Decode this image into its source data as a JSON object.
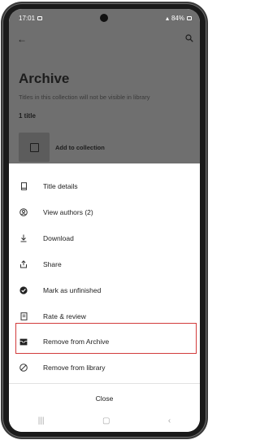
{
  "status_bar": {
    "time": "17:01",
    "battery": "84%"
  },
  "background": {
    "title": "Archive",
    "subtitle": "Titles in this collection will not be visible in library",
    "count": "1 title",
    "add_label": "Add to collection"
  },
  "menu": {
    "items": [
      {
        "label": "Title details",
        "icon": "book-icon"
      },
      {
        "label": "View authors (2)",
        "icon": "author-icon"
      },
      {
        "label": "Download",
        "icon": "download-icon"
      },
      {
        "label": "Share",
        "icon": "share-icon"
      },
      {
        "label": "Mark as unfinished",
        "icon": "check-circle-icon"
      },
      {
        "label": "Rate & review",
        "icon": "review-icon"
      },
      {
        "label": "Remove from Archive",
        "icon": "archive-icon"
      },
      {
        "label": "Remove from library",
        "icon": "ban-icon"
      }
    ],
    "close_label": "Close"
  },
  "colors": {
    "highlight": "#d23b3b",
    "dim_overlay": "#6f6f6f"
  }
}
